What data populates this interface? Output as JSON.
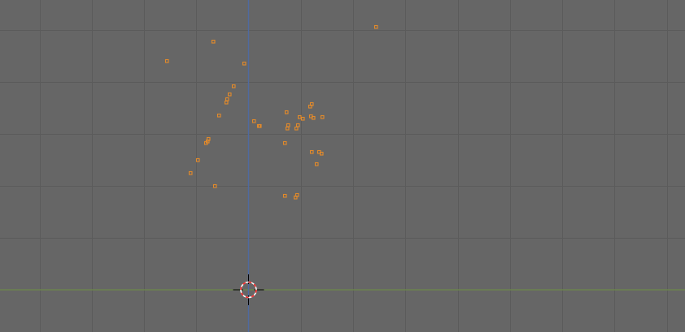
{
  "viewport": {
    "background": "#666666",
    "grid_color": "#5b5b5b",
    "x_axis_color": "#6d8a4a",
    "y_axis_color": "#4f6aa0"
  },
  "selection": {
    "vertex_color": "#e38a2a",
    "state": "selected"
  },
  "cursor_3d": {
    "icon": "3d-cursor-icon",
    "ring_color_a": "#ff2a2a",
    "ring_color_b": "#ffffff"
  }
}
